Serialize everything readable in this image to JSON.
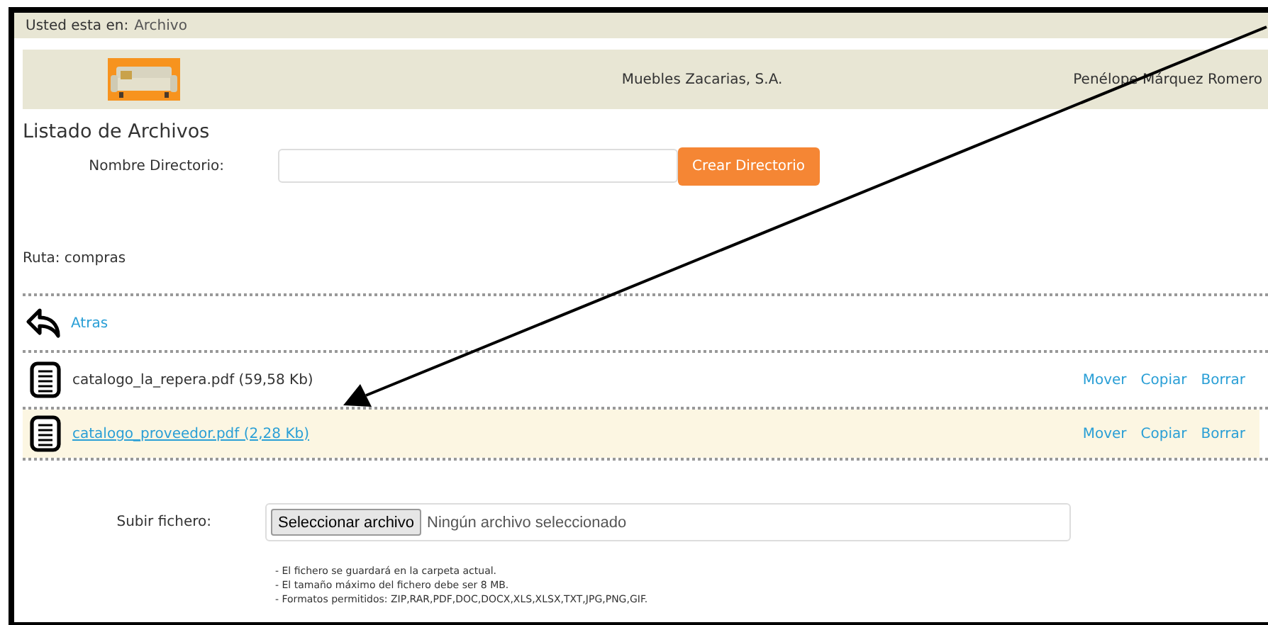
{
  "breadcrumb": {
    "label": "Usted esta en:",
    "current": "Archivo"
  },
  "header": {
    "company": "Muebles Zacarias, S.A.",
    "user": "Penélope Márquez Romero"
  },
  "title": "Listado de Archivos",
  "directory_form": {
    "label": "Nombre Directorio:",
    "button": "Crear Directorio"
  },
  "path": "Ruta: compras",
  "back_link": "Atras",
  "files": [
    {
      "name": "catalogo_la_repera.pdf (59,58 Kb)",
      "highlighted": false,
      "actions": [
        "Mover",
        "Copiar",
        "Borrar"
      ]
    },
    {
      "name": "catalogo_proveedor.pdf (2,28 Kb)",
      "highlighted": true,
      "actions": [
        "Mover",
        "Copiar",
        "Borrar"
      ]
    }
  ],
  "upload": {
    "label": "Subir fichero:",
    "button": "Seleccionar archivo",
    "status": "Ningún archivo seleccionado",
    "notes": [
      "- El fichero se guardará en la carpeta actual.",
      "- El tamaño máximo del fichero debe ser 8 MB.",
      "- Formatos permitidos: ZIP,RAR,PDF,DOC,DOCX,XLS,XLSX,TXT,JPG,PNG,GIF."
    ]
  }
}
